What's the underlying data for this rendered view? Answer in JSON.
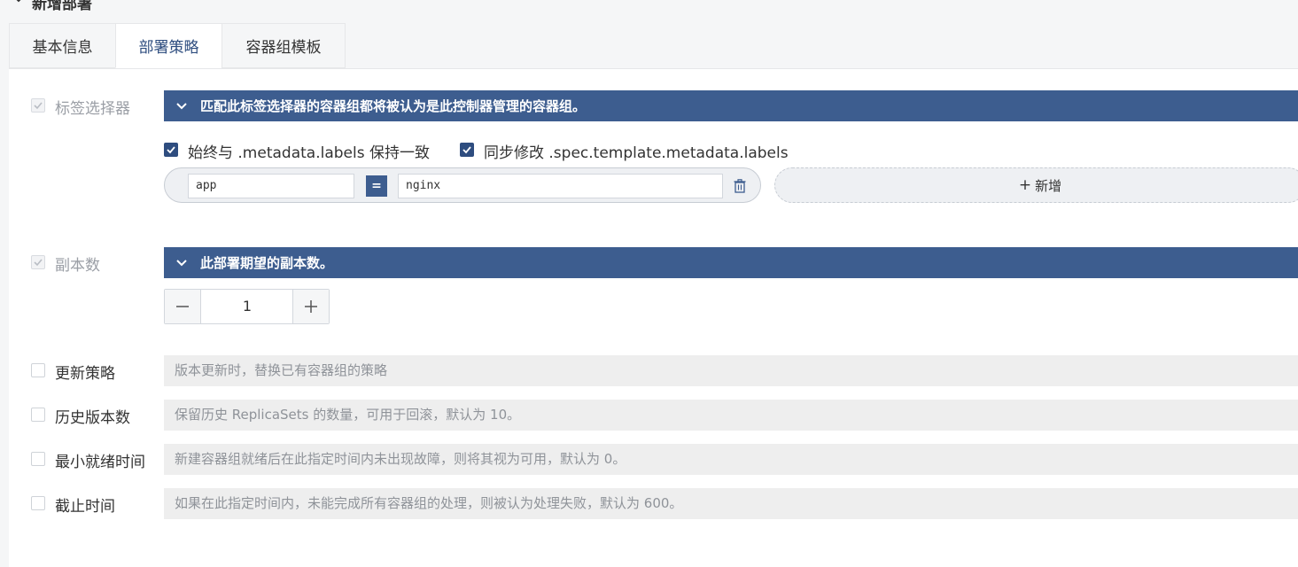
{
  "page": {
    "section_title": "新增部署"
  },
  "tabs": [
    {
      "label": "基本信息"
    },
    {
      "label": "部署策略"
    },
    {
      "label": "容器组模板"
    }
  ],
  "selector": {
    "label": "标签选择器",
    "header": "匹配此标签选择器的容器组都将被认为是此控制器管理的容器组。",
    "sync_labels": "始终与 .metadata.labels 保持一致",
    "sync_template": "同步修改 .spec.template.metadata.labels",
    "key": "app",
    "operator": "=",
    "value": "nginx",
    "add_label": "新增"
  },
  "replicas": {
    "label": "副本数",
    "header": "此部署期望的副本数。",
    "value": "1"
  },
  "update_strategy": {
    "label": "更新策略",
    "desc": "版本更新时，替换已有容器组的策略"
  },
  "revision_history": {
    "label": "历史版本数",
    "desc": "保留历史 ReplicaSets 的数量，可用于回滚，默认为 10。"
  },
  "min_ready": {
    "label": "最小就绪时间",
    "desc": "新建容器组就绪后在此指定时间内未出现故障，则将其视为可用，默认为 0。"
  },
  "deadline": {
    "label": "截止时间",
    "desc": "如果在此指定时间内，未能完成所有容器组的处理，则被认为处理失败，默认为 600。"
  },
  "colors": {
    "accent": "#3d5d8f",
    "tab_active_text": "#2e4d7f"
  }
}
